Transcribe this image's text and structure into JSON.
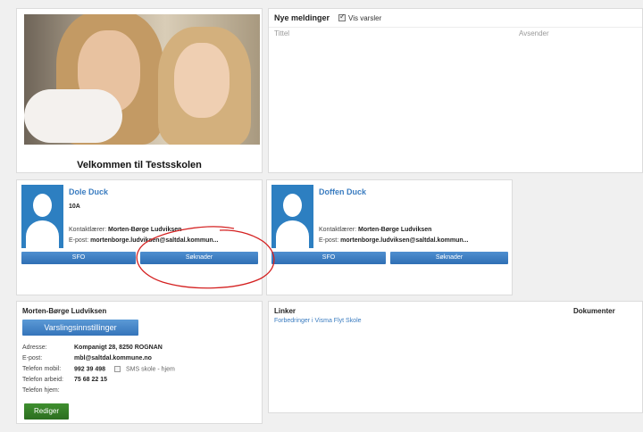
{
  "welcome": {
    "title": "Velkommen til Testsskolen"
  },
  "messages": {
    "header": "Nye meldinger",
    "show_alerts_label": "Vis varsler",
    "columns": [
      "Tittel",
      "Avsender"
    ]
  },
  "children": [
    {
      "name": "Dole Duck",
      "class": "10A",
      "contact_label": "Kontaktlærer:",
      "contact_value": "Morten-Børge Ludviksen",
      "email_label": "E-post:",
      "email_value": "mortenborge.ludviksen@saltdal.kommun...",
      "buttons": [
        "SFO",
        "Søknader"
      ]
    },
    {
      "name": "Doffen Duck",
      "contact_label": "Kontaktlærer:",
      "contact_value": "Morten-Børge Ludviksen",
      "email_label": "E-post:",
      "email_value": "mortenborge.ludviksen@saltdal.kommun...",
      "buttons": [
        "SFO",
        "Søknader"
      ]
    }
  ],
  "contact": {
    "name": "Morten-Børge Ludviksen",
    "settings_button": "Varslingsinnstillinger",
    "rows": [
      {
        "label": "Adresse:",
        "value": "Kompanigt 28, 8250 ROGNAN"
      },
      {
        "label": "E-post:",
        "value": "mbl@saltdal.kommune.no"
      },
      {
        "label": "Telefon mobil:",
        "value": "992 39 498",
        "sms_label": "SMS skole - hjem"
      },
      {
        "label": "Telefon arbeid:",
        "value": "75 68 22 15"
      },
      {
        "label": "Telefon hjem:",
        "value": ""
      }
    ],
    "edit_button": "Rediger"
  },
  "links": {
    "header": "Linker",
    "docs_header": "Dokumenter",
    "items": [
      "Forbedringer i Visma Flyt Skole"
    ]
  },
  "colors": {
    "brand_blue": "#2f6fb4",
    "link_blue": "#3a7cc0",
    "edit_green": "#2c6e20",
    "annotation_red": "#d42020"
  }
}
